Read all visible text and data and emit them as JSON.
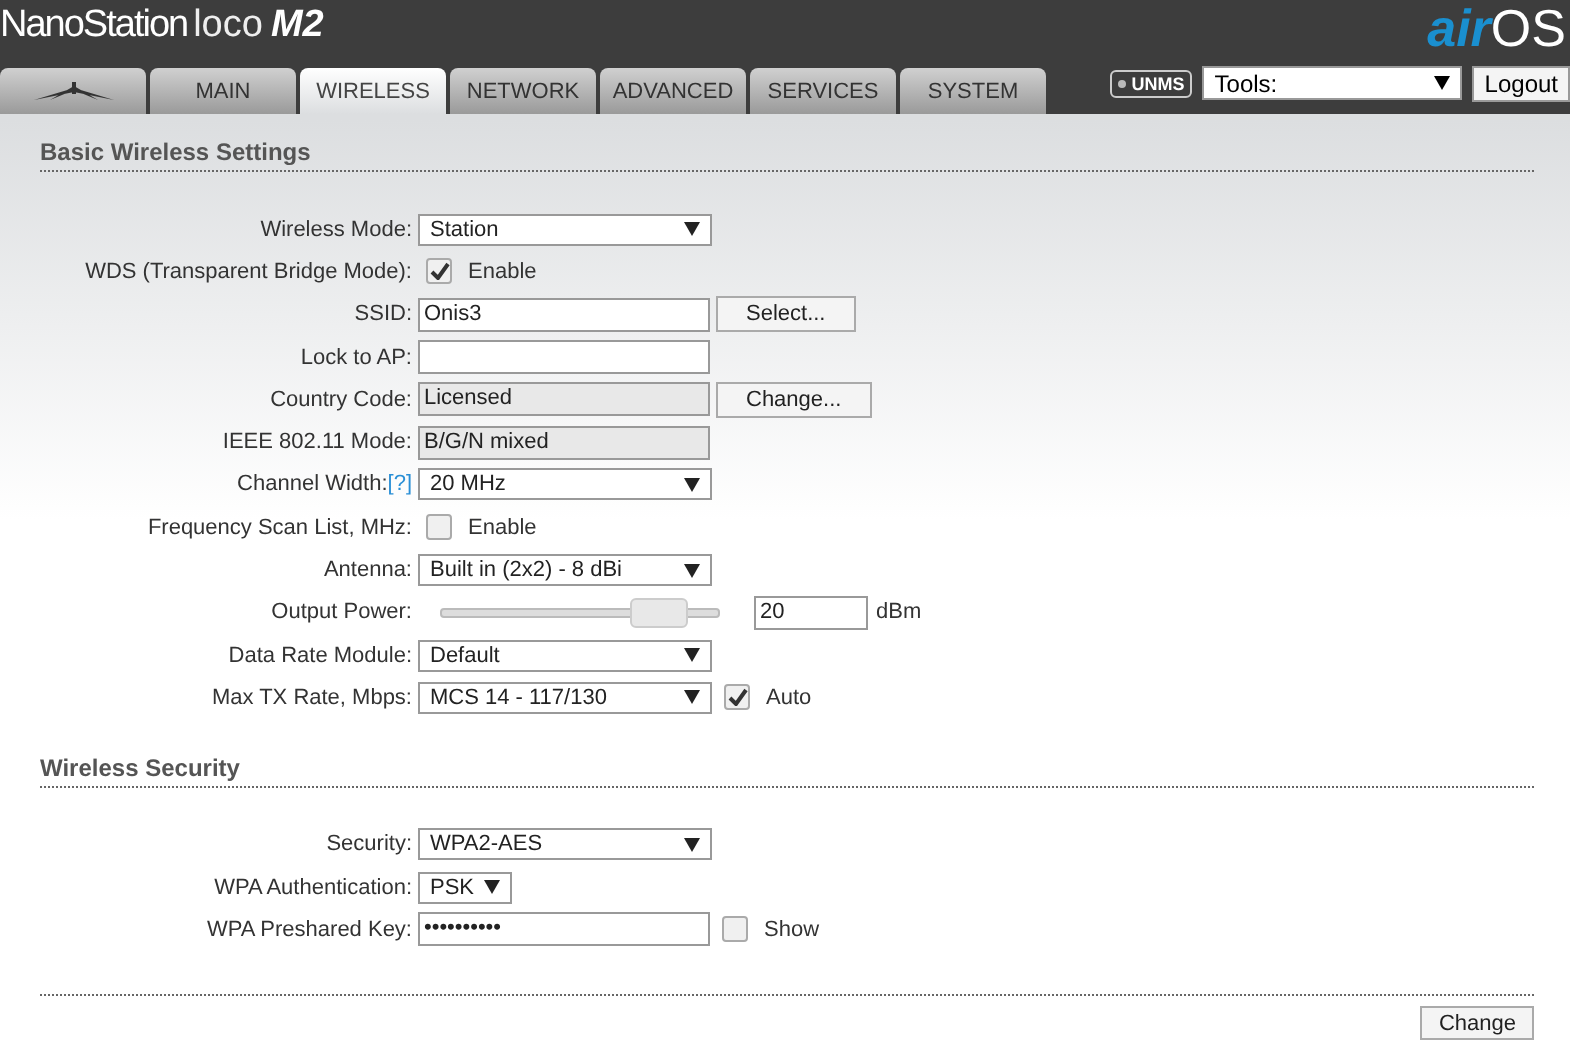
{
  "brand": {
    "product": "NanoStation",
    "line": "loco",
    "model": "M2",
    "os_prefix": "air",
    "os_suffix": "OS"
  },
  "tabs": [
    {
      "kind": "logo",
      "selected": false
    },
    {
      "label": "MAIN",
      "selected": false
    },
    {
      "label": "WIRELESS",
      "selected": true
    },
    {
      "label": "NETWORK",
      "selected": false
    },
    {
      "label": "ADVANCED",
      "selected": false
    },
    {
      "label": "SERVICES",
      "selected": false
    },
    {
      "label": "SYSTEM",
      "selected": false
    }
  ],
  "toolbar": {
    "badge": "UNMS",
    "tools": "Tools:",
    "logout": "Logout"
  },
  "sections": [
    {
      "title": "Basic Wireless Settings",
      "rows": [
        {
          "label": "Wireless Mode:",
          "kind": "select",
          "value": "Station"
        },
        {
          "label": "WDS (Transparent Bridge Mode):",
          "kind": "checkbox",
          "checked": true,
          "text": "Enable"
        },
        {
          "label": "SSID:",
          "kind": "input",
          "value": "Onis3",
          "button": "Select..."
        },
        {
          "label": "Lock to AP:",
          "kind": "input"
        },
        {
          "label": "Country Code:",
          "kind": "readonly",
          "value": "Licensed",
          "button": "Change..."
        },
        {
          "label": "IEEE 802.11 Mode:",
          "kind": "readonly",
          "value": "B/G/N mixed"
        },
        {
          "label": "Channel Width:",
          "help": "[?]",
          "kind": "select",
          "value": "20 MHz"
        },
        {
          "label": "Frequency Scan List, MHz:",
          "kind": "checkbox",
          "checked": false,
          "text": "Enable"
        },
        {
          "label": "Antenna:",
          "kind": "select",
          "value": "Built in (2x2) - 8 dBi"
        },
        {
          "label": "Output Power:",
          "kind": "slider",
          "level": 0.85,
          "value": "20",
          "unit": "dBm"
        },
        {
          "label": "Data Rate Module:",
          "kind": "select",
          "value": "Default"
        },
        {
          "label": "Max TX Rate, Mbps:",
          "kind": "select",
          "value": "MCS 14 - 117/130",
          "check": {
            "checked": true,
            "text": "Auto"
          }
        }
      ]
    },
    {
      "title": "Wireless Security",
      "rows": [
        {
          "label": "Security:",
          "kind": "select",
          "value": "WPA2-AES"
        },
        {
          "label": "WPA Authentication:",
          "kind": "short-select",
          "value": "PSK"
        },
        {
          "label": "WPA Preshared Key:",
          "kind": "input",
          "value": "••••••••••",
          "check": {
            "checked": false,
            "text": "Show"
          }
        }
      ]
    }
  ],
  "submit": "Change"
}
